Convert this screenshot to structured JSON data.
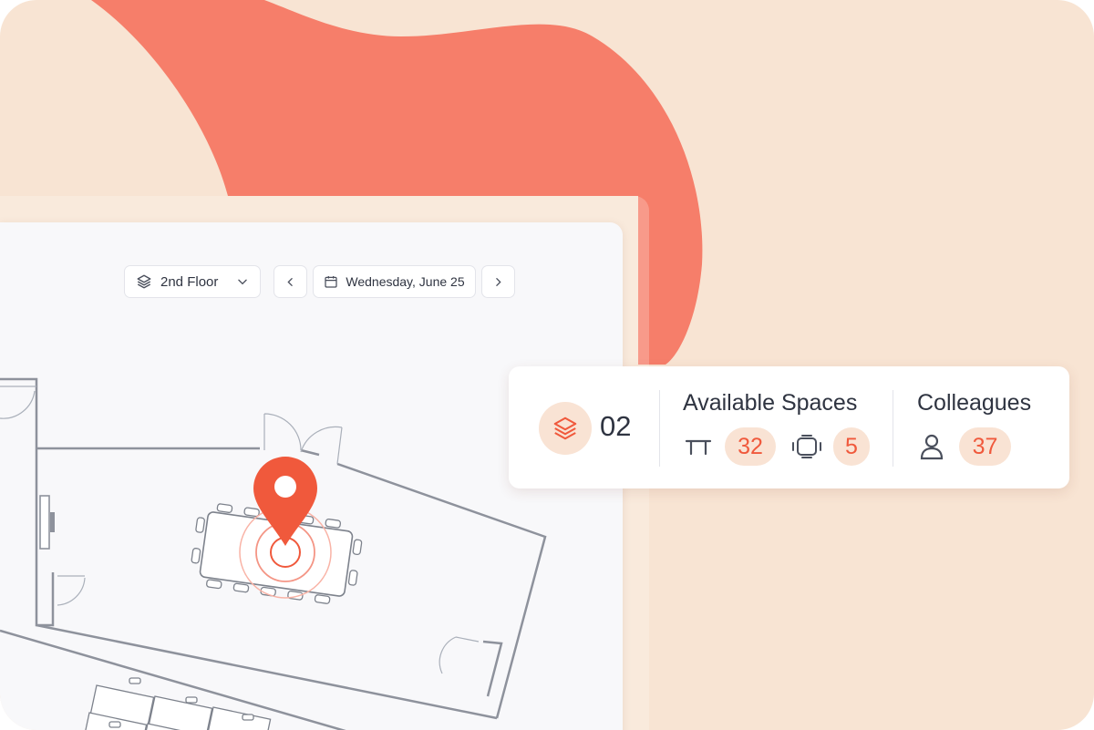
{
  "toolbar": {
    "floor_label": "2nd Floor",
    "date_label": "Wednesday, June 25"
  },
  "summary": {
    "floor_number": "02",
    "available_title": "Available Spaces",
    "desks_count": "32",
    "rooms_count": "5",
    "colleagues_title": "Colleagues",
    "colleagues_count": "37"
  },
  "colors": {
    "accent": "#f0593c",
    "blob": "#f67e6a",
    "background": "#f8e4d3",
    "pill": "#f9e3d4"
  },
  "icons": [
    "layers-icon",
    "chevron-down-icon",
    "chevron-left-icon",
    "calendar-icon",
    "chevron-right-icon",
    "desk-icon",
    "meeting-room-icon",
    "person-icon",
    "location-pin-icon"
  ]
}
